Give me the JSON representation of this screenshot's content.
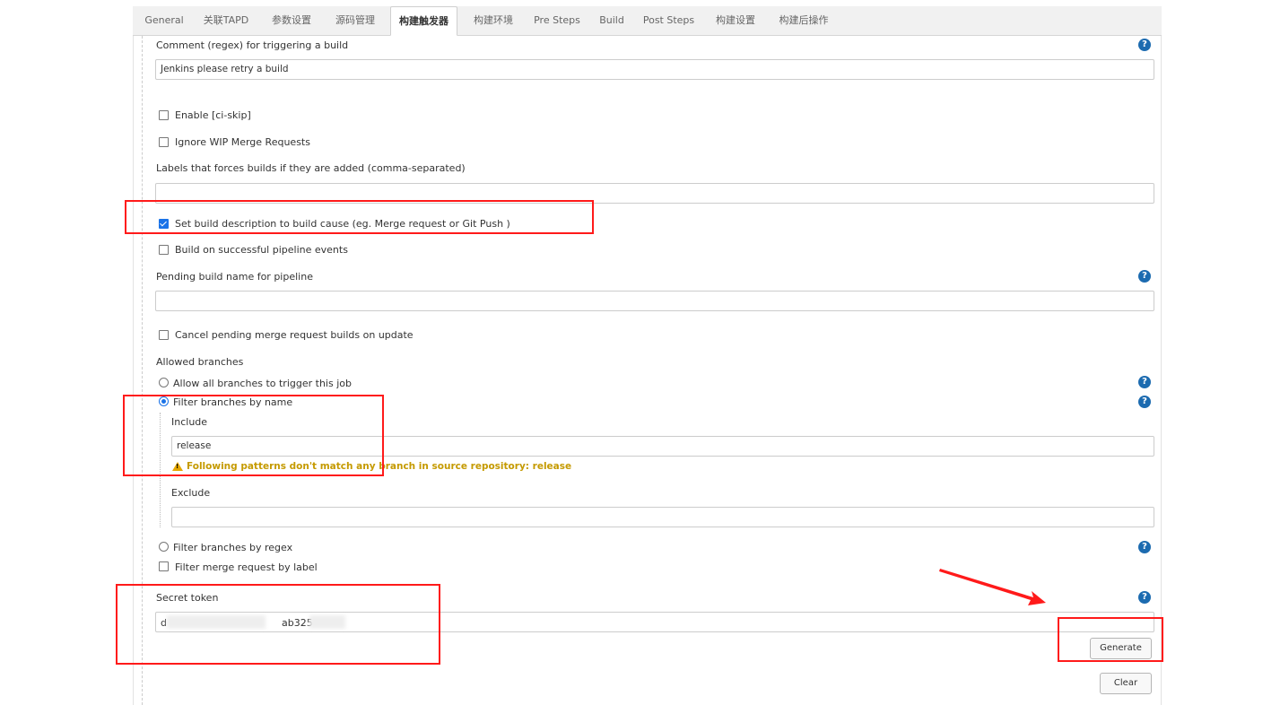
{
  "tabs": [
    {
      "label": "General",
      "active": false
    },
    {
      "label": "关联TAPD",
      "active": false
    },
    {
      "label": "参数设置",
      "active": false
    },
    {
      "label": "源码管理",
      "active": false
    },
    {
      "label": "构建触发器",
      "active": true
    },
    {
      "label": "构建环境",
      "active": false
    },
    {
      "label": "Pre Steps",
      "active": false
    },
    {
      "label": "Build",
      "active": false
    },
    {
      "label": "Post Steps",
      "active": false
    },
    {
      "label": "构建设置",
      "active": false
    },
    {
      "label": "构建后操作",
      "active": false
    }
  ],
  "form": {
    "comment_regex_label": "Comment (regex) for triggering a build",
    "comment_regex_value": "Jenkins please retry a build",
    "enable_ci_skip_label": "Enable [ci-skip]",
    "enable_ci_skip_checked": false,
    "ignore_wip_label": "Ignore WIP Merge Requests",
    "ignore_wip_checked": false,
    "labels_force_label": "Labels that forces builds if they are added (comma-separated)",
    "labels_force_value": "",
    "set_build_description_label": "Set build description to build cause (eg. Merge request or Git Push )",
    "set_build_description_checked": true,
    "build_on_pipeline_label": "Build on successful pipeline events",
    "build_on_pipeline_checked": false,
    "pending_build_name_label": "Pending build name for pipeline",
    "pending_build_name_value": "",
    "cancel_pending_label": "Cancel pending merge request builds on update",
    "cancel_pending_checked": false,
    "allowed_branches_label": "Allowed branches",
    "radio_all_branches_label": "Allow all branches to trigger this job",
    "radio_filter_by_name_label": "Filter branches by name",
    "selected_branch_option": "Filter branches by name",
    "include_label": "Include",
    "include_value": "release",
    "include_warning": "Following patterns don't match any branch in source repository: release",
    "exclude_label": "Exclude",
    "exclude_value": "",
    "radio_filter_by_regex_label": "Filter branches by regex",
    "filter_mr_by_label_label": "Filter merge request by label",
    "filter_mr_by_label_checked": false,
    "secret_token_label": "Secret token",
    "secret_token_visible_start": "d",
    "secret_token_visible_fragment": "ab325",
    "generate_button": "Generate",
    "clear_button": "Clear"
  },
  "icons": {
    "help": "?",
    "warning": "!"
  },
  "colors": {
    "annotation_red": "#ff1a1a",
    "help_icon": "#1c6bb0",
    "warning_text": "#c59a00",
    "checkbox_checked": "#1a73e8"
  }
}
